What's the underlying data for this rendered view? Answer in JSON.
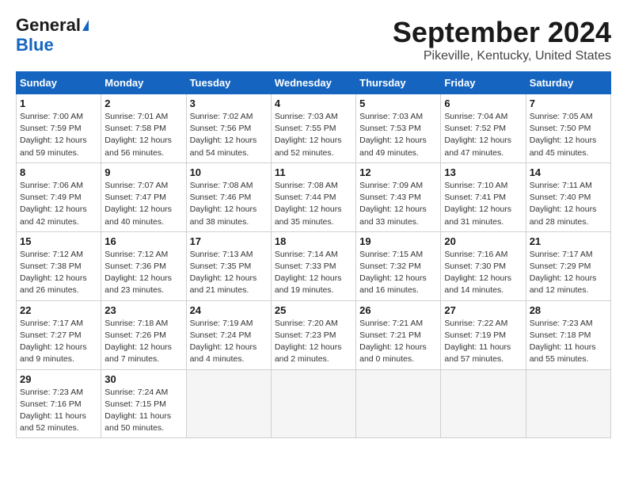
{
  "header": {
    "logo_line1": "General",
    "logo_line2": "Blue",
    "title": "September 2024",
    "subtitle": "Pikeville, Kentucky, United States"
  },
  "days_of_week": [
    "Sunday",
    "Monday",
    "Tuesday",
    "Wednesday",
    "Thursday",
    "Friday",
    "Saturday"
  ],
  "weeks": [
    [
      {
        "num": "1",
        "rise": "7:00 AM",
        "set": "7:59 PM",
        "daylight": "12 hours and 59 minutes."
      },
      {
        "num": "2",
        "rise": "7:01 AM",
        "set": "7:58 PM",
        "daylight": "12 hours and 56 minutes."
      },
      {
        "num": "3",
        "rise": "7:02 AM",
        "set": "7:56 PM",
        "daylight": "12 hours and 54 minutes."
      },
      {
        "num": "4",
        "rise": "7:03 AM",
        "set": "7:55 PM",
        "daylight": "12 hours and 52 minutes."
      },
      {
        "num": "5",
        "rise": "7:03 AM",
        "set": "7:53 PM",
        "daylight": "12 hours and 49 minutes."
      },
      {
        "num": "6",
        "rise": "7:04 AM",
        "set": "7:52 PM",
        "daylight": "12 hours and 47 minutes."
      },
      {
        "num": "7",
        "rise": "7:05 AM",
        "set": "7:50 PM",
        "daylight": "12 hours and 45 minutes."
      }
    ],
    [
      {
        "num": "8",
        "rise": "7:06 AM",
        "set": "7:49 PM",
        "daylight": "12 hours and 42 minutes."
      },
      {
        "num": "9",
        "rise": "7:07 AM",
        "set": "7:47 PM",
        "daylight": "12 hours and 40 minutes."
      },
      {
        "num": "10",
        "rise": "7:08 AM",
        "set": "7:46 PM",
        "daylight": "12 hours and 38 minutes."
      },
      {
        "num": "11",
        "rise": "7:08 AM",
        "set": "7:44 PM",
        "daylight": "12 hours and 35 minutes."
      },
      {
        "num": "12",
        "rise": "7:09 AM",
        "set": "7:43 PM",
        "daylight": "12 hours and 33 minutes."
      },
      {
        "num": "13",
        "rise": "7:10 AM",
        "set": "7:41 PM",
        "daylight": "12 hours and 31 minutes."
      },
      {
        "num": "14",
        "rise": "7:11 AM",
        "set": "7:40 PM",
        "daylight": "12 hours and 28 minutes."
      }
    ],
    [
      {
        "num": "15",
        "rise": "7:12 AM",
        "set": "7:38 PM",
        "daylight": "12 hours and 26 minutes."
      },
      {
        "num": "16",
        "rise": "7:12 AM",
        "set": "7:36 PM",
        "daylight": "12 hours and 23 minutes."
      },
      {
        "num": "17",
        "rise": "7:13 AM",
        "set": "7:35 PM",
        "daylight": "12 hours and 21 minutes."
      },
      {
        "num": "18",
        "rise": "7:14 AM",
        "set": "7:33 PM",
        "daylight": "12 hours and 19 minutes."
      },
      {
        "num": "19",
        "rise": "7:15 AM",
        "set": "7:32 PM",
        "daylight": "12 hours and 16 minutes."
      },
      {
        "num": "20",
        "rise": "7:16 AM",
        "set": "7:30 PM",
        "daylight": "12 hours and 14 minutes."
      },
      {
        "num": "21",
        "rise": "7:17 AM",
        "set": "7:29 PM",
        "daylight": "12 hours and 12 minutes."
      }
    ],
    [
      {
        "num": "22",
        "rise": "7:17 AM",
        "set": "7:27 PM",
        "daylight": "12 hours and 9 minutes."
      },
      {
        "num": "23",
        "rise": "7:18 AM",
        "set": "7:26 PM",
        "daylight": "12 hours and 7 minutes."
      },
      {
        "num": "24",
        "rise": "7:19 AM",
        "set": "7:24 PM",
        "daylight": "12 hours and 4 minutes."
      },
      {
        "num": "25",
        "rise": "7:20 AM",
        "set": "7:23 PM",
        "daylight": "12 hours and 2 minutes."
      },
      {
        "num": "26",
        "rise": "7:21 AM",
        "set": "7:21 PM",
        "daylight": "12 hours and 0 minutes."
      },
      {
        "num": "27",
        "rise": "7:22 AM",
        "set": "7:19 PM",
        "daylight": "11 hours and 57 minutes."
      },
      {
        "num": "28",
        "rise": "7:23 AM",
        "set": "7:18 PM",
        "daylight": "11 hours and 55 minutes."
      }
    ],
    [
      {
        "num": "29",
        "rise": "7:23 AM",
        "set": "7:16 PM",
        "daylight": "11 hours and 52 minutes."
      },
      {
        "num": "30",
        "rise": "7:24 AM",
        "set": "7:15 PM",
        "daylight": "11 hours and 50 minutes."
      },
      null,
      null,
      null,
      null,
      null
    ]
  ]
}
